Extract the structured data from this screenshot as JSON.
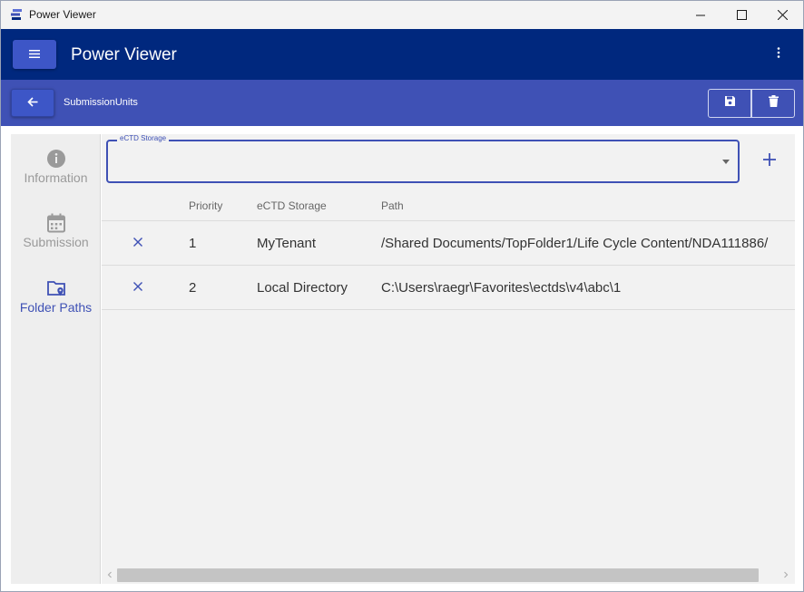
{
  "window": {
    "title": "Power Viewer"
  },
  "appbar": {
    "title": "Power Viewer"
  },
  "subbar": {
    "title": "SubmissionUnits"
  },
  "sidebar": {
    "items": [
      {
        "label": "Information",
        "icon": "info-icon",
        "active": false
      },
      {
        "label": "Submission",
        "icon": "calendar-icon",
        "active": false
      },
      {
        "label": "Folder Paths",
        "icon": "folder-location-icon",
        "active": true
      }
    ]
  },
  "storage_select": {
    "label": "eCTD Storage",
    "value": ""
  },
  "table": {
    "headers": {
      "priority": "Priority",
      "storage": "eCTD Storage",
      "path": "Path"
    },
    "rows": [
      {
        "priority": "1",
        "storage": "MyTenant",
        "path": "/Shared Documents/TopFolder1/Life Cycle Content/NDA111886/"
      },
      {
        "priority": "2",
        "storage": "Local Directory",
        "path": "C:\\Users\\raegr\\Favorites\\ectds\\v4\\abc\\1"
      }
    ]
  },
  "colors": {
    "appbar": "#00287e",
    "subbar": "#3f51b5",
    "accent": "#3f51b5",
    "button": "#3d56c7"
  }
}
